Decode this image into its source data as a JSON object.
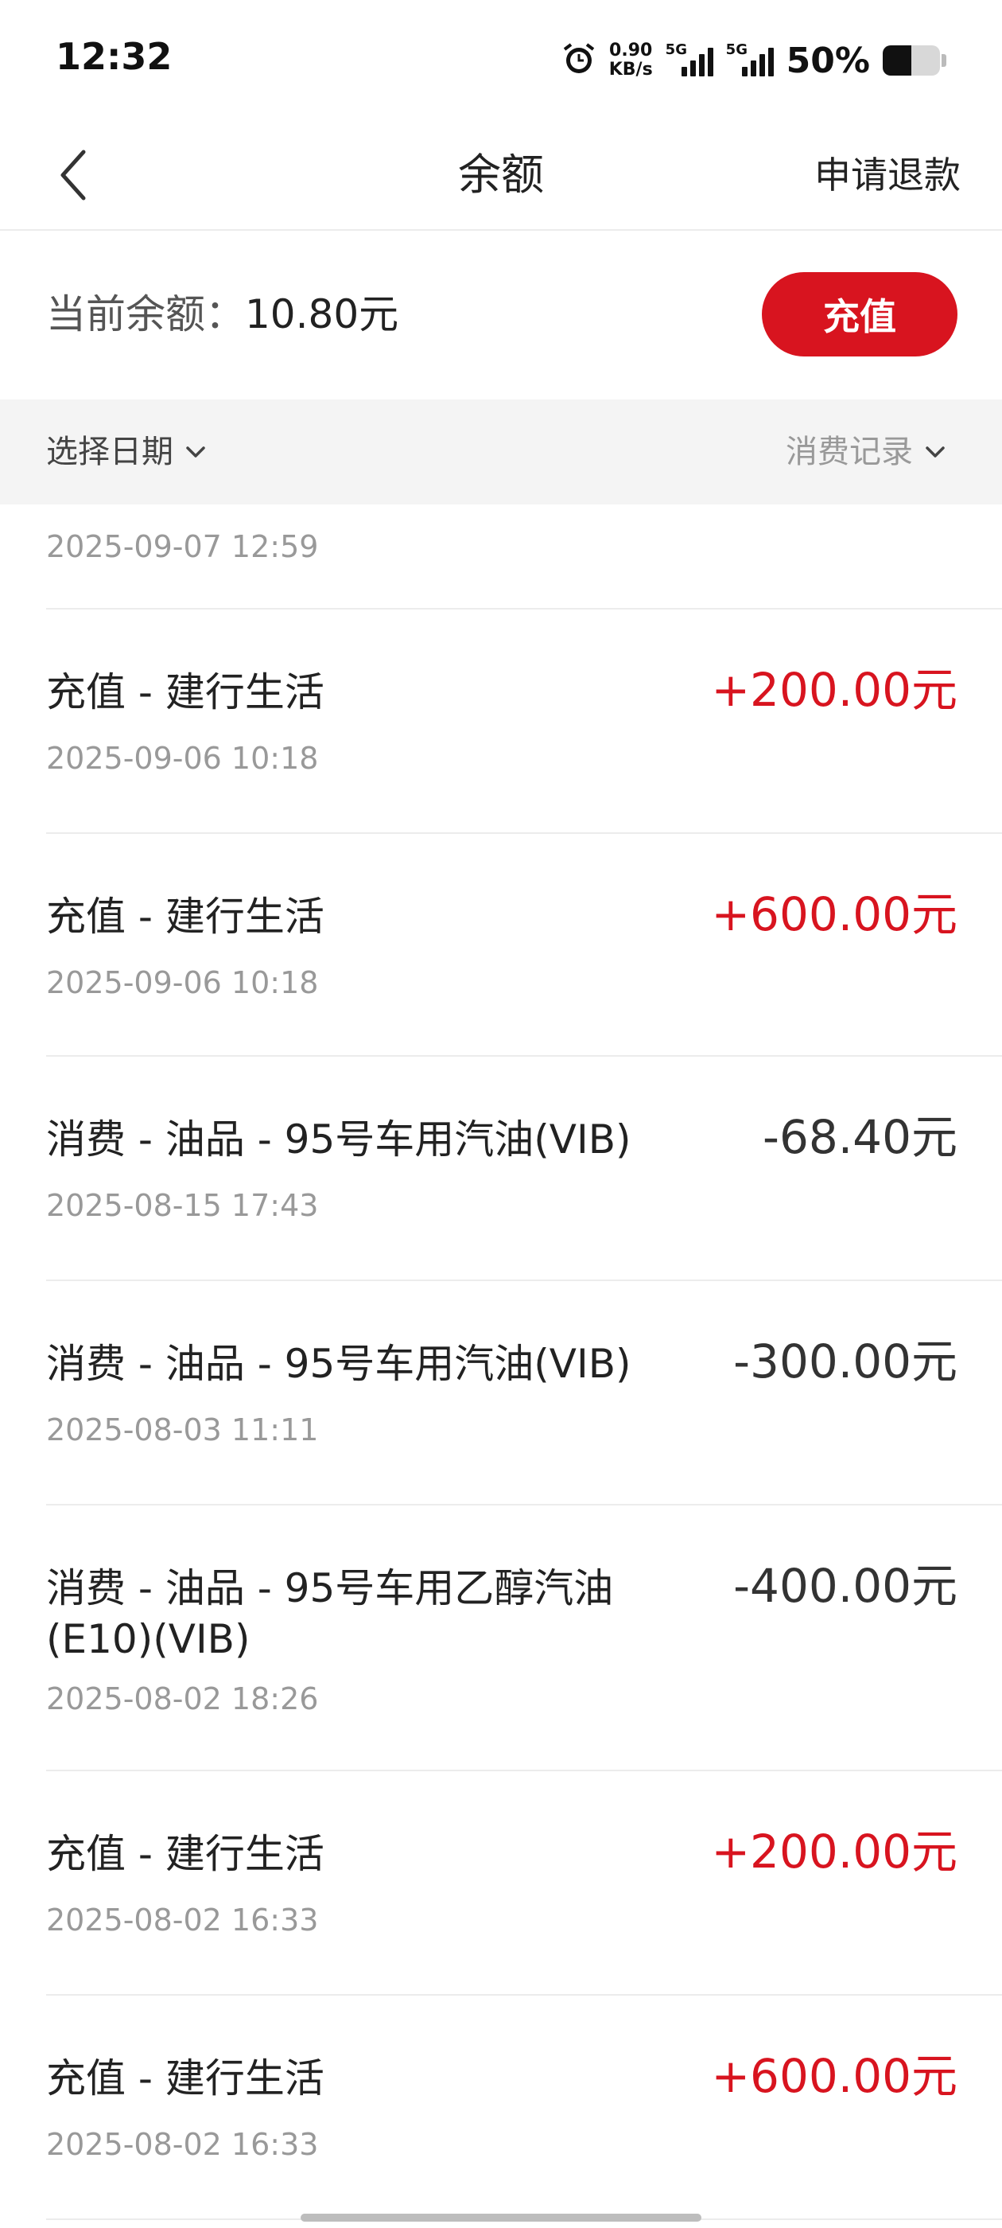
{
  "status_bar": {
    "time": "12:32",
    "net_speed_value": "0.90",
    "net_speed_unit": "KB/s",
    "sim1_tag": "5G",
    "sim2_tag": "5G",
    "battery_text": "50%",
    "battery_level": 0.5,
    "icons": [
      "alarm-icon",
      "signal-icon",
      "signal-icon",
      "battery-icon"
    ]
  },
  "nav": {
    "back_icon": "chevron-left-icon",
    "title": "余额",
    "refund_label": "申请退款"
  },
  "balance": {
    "label": "当前余额：",
    "value": "10.80元",
    "recharge_label": "充值"
  },
  "filters": {
    "date_label": "选择日期",
    "type_label": "消费记录"
  },
  "records": {
    "partial_time": "2025-09-07 12:59",
    "items": [
      {
        "title": "充值 - 建行生活",
        "amount": "+200.00元",
        "time": "2025-09-06 10:18",
        "kind": "credit"
      },
      {
        "title": "充值 - 建行生活",
        "amount": "+600.00元",
        "time": "2025-09-06 10:18",
        "kind": "credit"
      },
      {
        "title": "消费 - 油品 - 95号车用汽油(VIB)",
        "amount": "-68.40元",
        "time": "2025-08-15 17:43",
        "kind": "debit"
      },
      {
        "title": "消费 - 油品 - 95号车用汽油(VIB)",
        "amount": "-300.00元",
        "time": "2025-08-03 11:11",
        "kind": "debit"
      },
      {
        "title": "消费 - 油品 - 95号车用乙醇汽油(E10)(VIB)",
        "amount": "-400.00元",
        "time": "2025-08-02 18:26",
        "kind": "debit"
      },
      {
        "title": "充值 - 建行生活",
        "amount": "+200.00元",
        "time": "2025-08-02 16:33",
        "kind": "credit"
      },
      {
        "title": "充值 - 建行生活",
        "amount": "+600.00元",
        "time": "2025-08-02 16:33",
        "kind": "credit"
      }
    ]
  },
  "colors": {
    "accent": "#d8141f",
    "credit": "#d8141f",
    "debit": "#333333",
    "muted": "#999999"
  }
}
